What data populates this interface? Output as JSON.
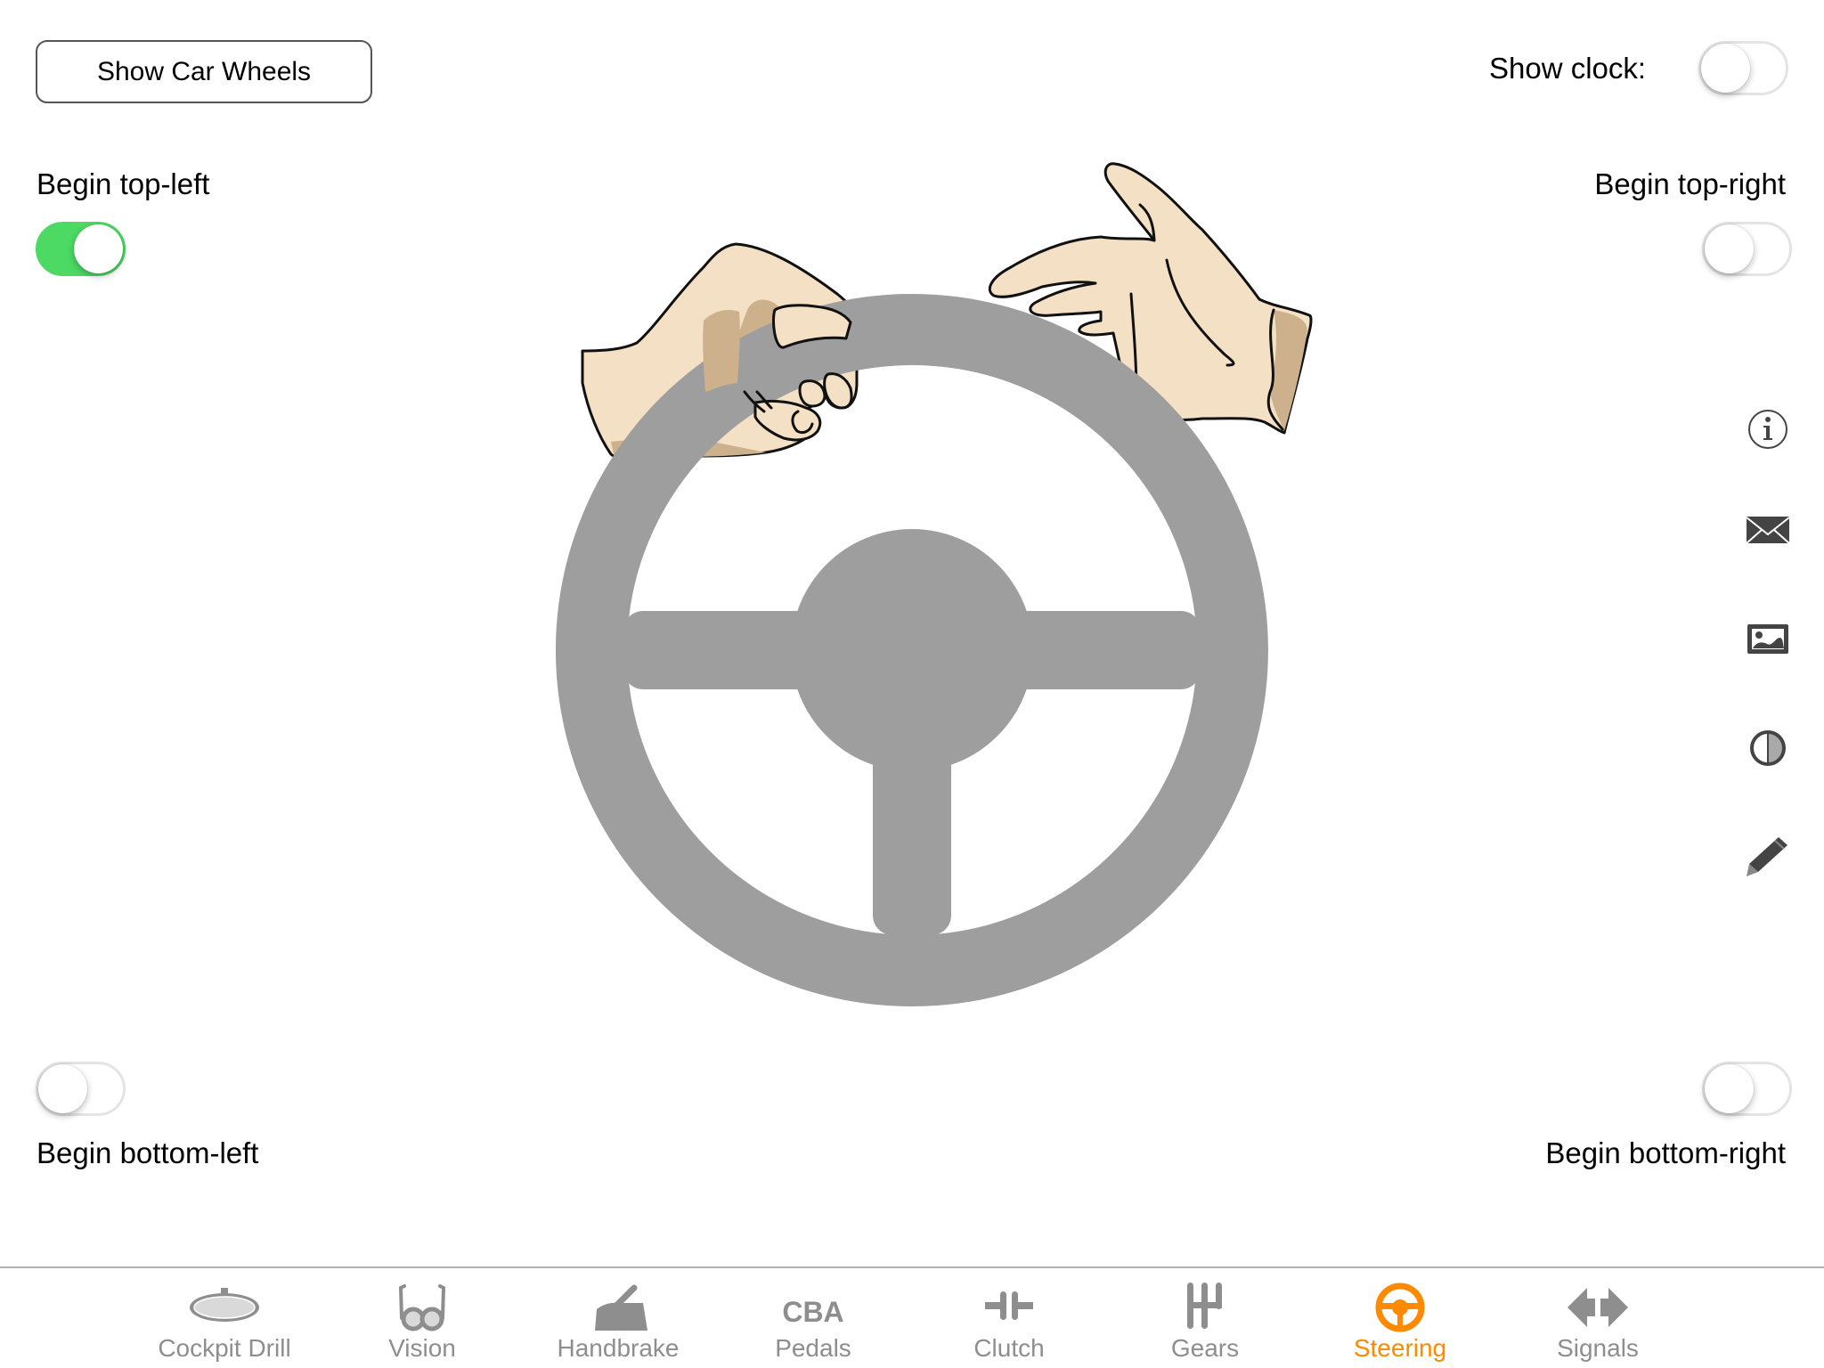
{
  "top_button": {
    "label": "Show Car Wheels"
  },
  "clock": {
    "label": "Show clock:",
    "on": false
  },
  "toggles": {
    "top_left": {
      "label": "Begin top-left",
      "on": true
    },
    "top_right": {
      "label": "Begin top-right",
      "on": false
    },
    "bottom_left": {
      "label": "Begin bottom-left",
      "on": false
    },
    "bottom_right": {
      "label": "Begin bottom-right",
      "on": false
    }
  },
  "side_icons": [
    {
      "name": "info-icon"
    },
    {
      "name": "mail-icon"
    },
    {
      "name": "image-icon"
    },
    {
      "name": "contrast-icon"
    },
    {
      "name": "pencil-icon"
    }
  ],
  "colors": {
    "accent": "#ff8a00",
    "switch_on": "#4cd964",
    "wheel": "#9e9e9e",
    "tab_inactive": "#8e8e8e",
    "icon_dark": "#444444",
    "skin": "#f4e0c4",
    "skin_shadow": "#cdb18d"
  },
  "tabs": [
    {
      "label": "Cockpit Drill",
      "icon": "mirror-icon",
      "active": false
    },
    {
      "label": "Vision",
      "icon": "glasses-icon",
      "active": false
    },
    {
      "label": "Handbrake",
      "icon": "handbrake-icon",
      "active": false
    },
    {
      "label": "Pedals",
      "icon": "pedals-cba-icon",
      "icon_text": "CBA",
      "active": false
    },
    {
      "label": "Clutch",
      "icon": "clutch-icon",
      "active": false
    },
    {
      "label": "Gears",
      "icon": "gear-shift-icon",
      "active": false
    },
    {
      "label": "Steering",
      "icon": "steering-wheel-icon",
      "active": true
    },
    {
      "label": "Signals",
      "icon": "signal-arrows-icon",
      "active": false
    }
  ]
}
